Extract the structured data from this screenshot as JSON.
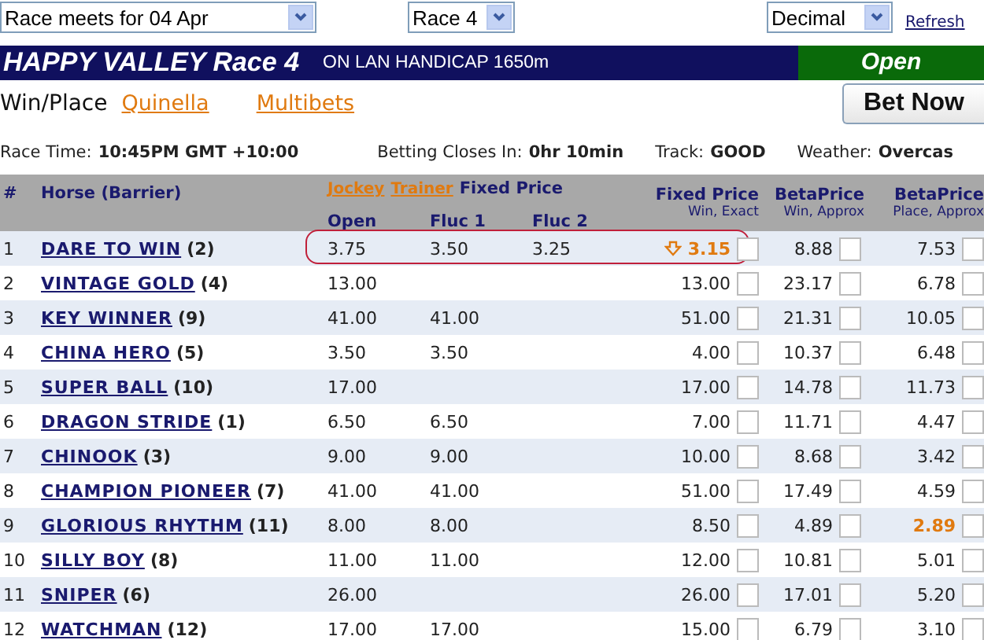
{
  "selectors": [
    {
      "value": "Race meets for 04 Apr"
    },
    {
      "value": "Race 4"
    },
    {
      "value": "Decimal"
    }
  ],
  "refresh_link": "Refresh",
  "title_bar": {
    "title": "HAPPY VALLEY Race 4",
    "subtitle": "ON LAN HANDICAP 1650m",
    "status": "Open"
  },
  "bet_types": [
    {
      "label": "Win/Place",
      "selected": true
    },
    {
      "label": "Quinella",
      "selected": false
    },
    {
      "label": "Multibets",
      "selected": false
    }
  ],
  "bet_button": "Bet Now",
  "race_info": [
    {
      "label": "Race Time:",
      "value": "10:45PM GMT +10:00"
    },
    {
      "label": "Betting Closes In:",
      "value": "0hr 10min"
    },
    {
      "label": "Track:",
      "value": "GOOD"
    },
    {
      "label": "Weather:",
      "value": "Overcas"
    }
  ],
  "table": {
    "number_label": "#",
    "horse_label": "Horse (Barrier)",
    "header_links": [
      "Jockey",
      "Trainer"
    ],
    "group_label": "Fixed Price",
    "columns": [
      "Open",
      "Fluc 1",
      "Fluc 2"
    ],
    "price_columns": [
      {
        "title": "Fixed Price",
        "subtitle": "Win, Exact"
      },
      {
        "title": "BetaPrice",
        "subtitle": "Win, Approx"
      },
      {
        "title": "BetaPrice",
        "subtitle": "Place, Approx"
      }
    ],
    "rows": [
      {
        "number": "1",
        "horse": "DARE TO WIN",
        "barrier": "(2)",
        "open": "3.75",
        "fluc_1": "3.50",
        "fluc_2": "3.25",
        "circled": true,
        "prices": [
          {
            "value": "3.15",
            "highlighted": true,
            "falling": true,
            "checked": false
          },
          {
            "value": "8.88",
            "highlighted": false,
            "checked": false
          },
          {
            "value": "7.53",
            "highlighted": false,
            "checked": false
          }
        ]
      },
      {
        "number": "2",
        "horse": "VINTAGE GOLD",
        "barrier": "(4)",
        "open": "13.00",
        "circled": false,
        "prices": [
          {
            "value": "13.00",
            "highlighted": false,
            "checked": false
          },
          {
            "value": "23.17",
            "highlighted": false,
            "checked": false
          },
          {
            "value": "6.78",
            "highlighted": false,
            "checked": false
          }
        ]
      },
      {
        "number": "3",
        "horse": "KEY WINNER",
        "barrier": "(9)",
        "open": "41.00",
        "fluc_1": "41.00",
        "circled": false,
        "prices": [
          {
            "value": "51.00",
            "highlighted": false,
            "checked": false
          },
          {
            "value": "21.31",
            "highlighted": false,
            "checked": false
          },
          {
            "value": "10.05",
            "highlighted": false,
            "checked": false
          }
        ]
      },
      {
        "number": "4",
        "horse": "CHINA HERO",
        "barrier": "(5)",
        "open": "3.50",
        "fluc_1": "3.50",
        "circled": false,
        "prices": [
          {
            "value": "4.00",
            "highlighted": false,
            "checked": false
          },
          {
            "value": "10.37",
            "highlighted": false,
            "checked": false
          },
          {
            "value": "6.48",
            "highlighted": false,
            "checked": false
          }
        ]
      },
      {
        "number": "5",
        "horse": "SUPER BALL",
        "barrier": "(10)",
        "open": "17.00",
        "circled": false,
        "prices": [
          {
            "value": "17.00",
            "highlighted": false,
            "checked": false
          },
          {
            "value": "14.78",
            "highlighted": false,
            "checked": false
          },
          {
            "value": "11.73",
            "highlighted": false,
            "checked": false
          }
        ]
      },
      {
        "number": "6",
        "horse": "DRAGON STRIDE",
        "barrier": "(1)",
        "open": "6.50",
        "fluc_1": "6.50",
        "circled": false,
        "prices": [
          {
            "value": "7.00",
            "highlighted": false,
            "checked": false
          },
          {
            "value": "11.71",
            "highlighted": false,
            "checked": false
          },
          {
            "value": "4.47",
            "highlighted": false,
            "checked": false
          }
        ]
      },
      {
        "number": "7",
        "horse": "CHINOOK",
        "barrier": "(3)",
        "open": "9.00",
        "fluc_1": "9.00",
        "circled": false,
        "prices": [
          {
            "value": "10.00",
            "highlighted": false,
            "checked": false
          },
          {
            "value": "8.68",
            "highlighted": false,
            "checked": false
          },
          {
            "value": "3.42",
            "highlighted": false,
            "checked": false
          }
        ]
      },
      {
        "number": "8",
        "horse": "CHAMPION PIONEER",
        "barrier": "(7)",
        "open": "41.00",
        "fluc_1": "41.00",
        "circled": false,
        "prices": [
          {
            "value": "51.00",
            "highlighted": false,
            "checked": false
          },
          {
            "value": "17.49",
            "highlighted": false,
            "checked": false
          },
          {
            "value": "4.59",
            "highlighted": false,
            "checked": false
          }
        ]
      },
      {
        "number": "9",
        "horse": "GLORIOUS RHYTHM",
        "barrier": "(11)",
        "open": "8.00",
        "fluc_1": "8.00",
        "circled": false,
        "prices": [
          {
            "value": "8.50",
            "highlighted": false,
            "checked": false
          },
          {
            "value": "4.89",
            "highlighted": false,
            "checked": false
          },
          {
            "value": "2.89",
            "highlighted": true,
            "checked": false
          }
        ]
      },
      {
        "number": "10",
        "horse": "SILLY BOY",
        "barrier": "(8)",
        "open": "11.00",
        "fluc_1": "11.00",
        "circled": false,
        "prices": [
          {
            "value": "12.00",
            "highlighted": false,
            "checked": false
          },
          {
            "value": "10.81",
            "highlighted": false,
            "checked": false
          },
          {
            "value": "5.01",
            "highlighted": false,
            "checked": false
          }
        ]
      },
      {
        "number": "11",
        "horse": "SNIPER",
        "barrier": "(6)",
        "open": "26.00",
        "circled": false,
        "prices": [
          {
            "value": "26.00",
            "highlighted": false,
            "checked": false
          },
          {
            "value": "17.01",
            "highlighted": false,
            "checked": false
          },
          {
            "value": "5.20",
            "highlighted": false,
            "checked": false
          }
        ]
      },
      {
        "number": "12",
        "horse": "WATCHMAN",
        "barrier": "(12)",
        "open": "17.00",
        "fluc_1": "17.00",
        "circled": false,
        "prices": [
          {
            "value": "15.00",
            "highlighted": false,
            "checked": false
          },
          {
            "value": "6.79",
            "highlighted": false,
            "checked": false
          },
          {
            "value": "3.10",
            "highlighted": false,
            "checked": false
          }
        ]
      }
    ]
  }
}
